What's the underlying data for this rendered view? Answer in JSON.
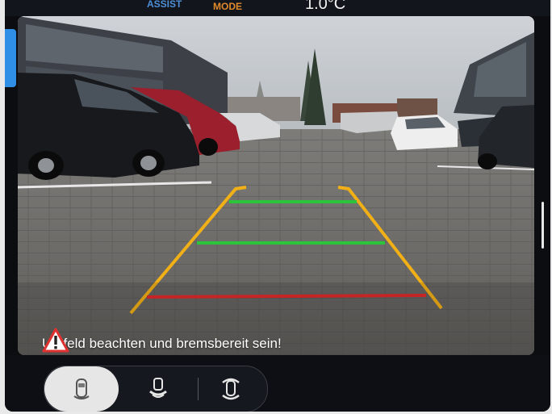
{
  "topbar": {
    "assist_label": "ASSIST",
    "mode_label": "MODE",
    "temperature": "1.0°C"
  },
  "camera": {
    "warning_text": "Umfeld beachten und bremsbereit sein!",
    "guide_colors": {
      "outer": "#f2b017",
      "near": "#e22b2b",
      "mid": "#2cc43a",
      "far": "#2cc43a"
    }
  },
  "view_buttons": [
    {
      "icon": "car-top-view-icon",
      "active": true
    },
    {
      "icon": "car-rear-sensor-icon",
      "active": false
    },
    {
      "icon": "car-front-sensor-icon",
      "active": false
    }
  ]
}
